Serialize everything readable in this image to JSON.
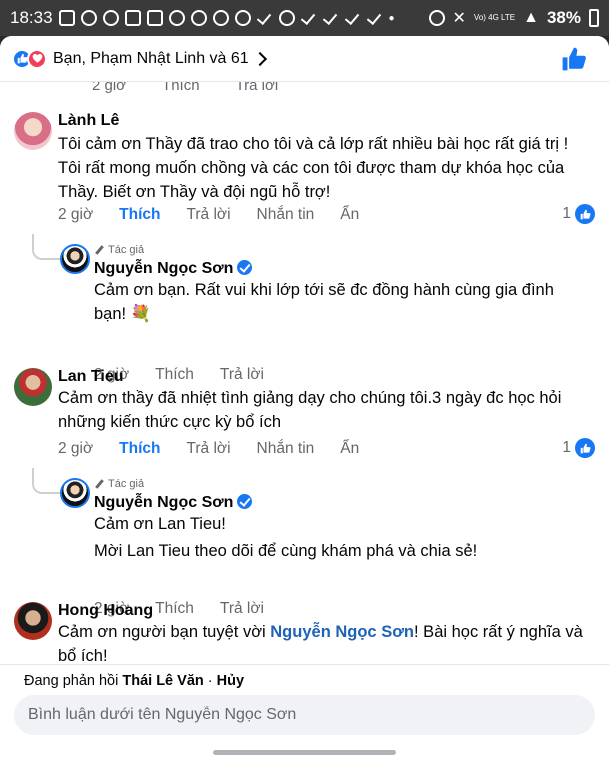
{
  "status": {
    "time": "18:33",
    "signal": "Vo) 4G LTE",
    "battery": "38%"
  },
  "header": {
    "reactors": "Bạn, Phạm Nhật Linh và 61"
  },
  "peek": {
    "time": "2 giờ",
    "like": "Thích",
    "reply": "Trả lời"
  },
  "comments": [
    {
      "author": "Lành Lê",
      "text": "Tôi cảm ơn Thầy đã trao cho tôi và cả lớp rất nhiều bài học rất giá trị ! Tôi rất mong muốn chồng và các con tôi được tham dự khóa học của Thầy.  Biết ơn Thầy và đội ngũ hỗ trợ!",
      "time": "2 giờ",
      "like": "Thích",
      "reply": "Trả lời",
      "message": "Nhắn tin",
      "hide": "Ẩn",
      "likes": "1",
      "replies": [
        {
          "badge": "Tác giả",
          "author": "Nguyễn Ngọc Sơn",
          "text": "Cảm ơn bạn. Rất vui khi lớp tới sẽ đc đồng hành cùng gia đình bạn! 💐",
          "time": "2 giờ",
          "like": "Thích",
          "reply": "Trả lời"
        }
      ]
    },
    {
      "author": "Lan Tieu",
      "text": "Cảm ơn thầy đã nhiệt tình giảng dạy cho chúng tôi.3 ngày đc học hỏi những kiến thức cực kỳ bổ ích",
      "time": "2 giờ",
      "like": "Thích",
      "reply": "Trả lời",
      "message": "Nhắn tin",
      "hide": "Ẩn",
      "likes": "1",
      "replies": [
        {
          "badge": "Tác giả",
          "author": "Nguyễn Ngọc Sơn",
          "line1": "Cảm ơn Lan Tieu!",
          "line2": "Mời Lan Tieu theo dõi để cùng khám phá và chia sẻ!",
          "time": "2 giờ",
          "like": "Thích",
          "reply": "Trả lời"
        }
      ]
    },
    {
      "author": "Hong Hoang",
      "text_before": "Cảm ơn người bạn tuyệt vời ",
      "mention": "Nguyễn Ngọc Sơn",
      "text_after": "! Bài học rất ý nghĩa và bổ ích!"
    }
  ],
  "composer": {
    "replying_prefix": "Đang phản hồi",
    "replying_name": "Thái Lê Văn",
    "cancel": "Hủy",
    "placeholder": "Bình luận dưới tên Nguyễn Ngọc Sơn"
  },
  "colors": {
    "accent": "#1877f2",
    "love": "#f33e58",
    "mention": "#1e63b5"
  }
}
